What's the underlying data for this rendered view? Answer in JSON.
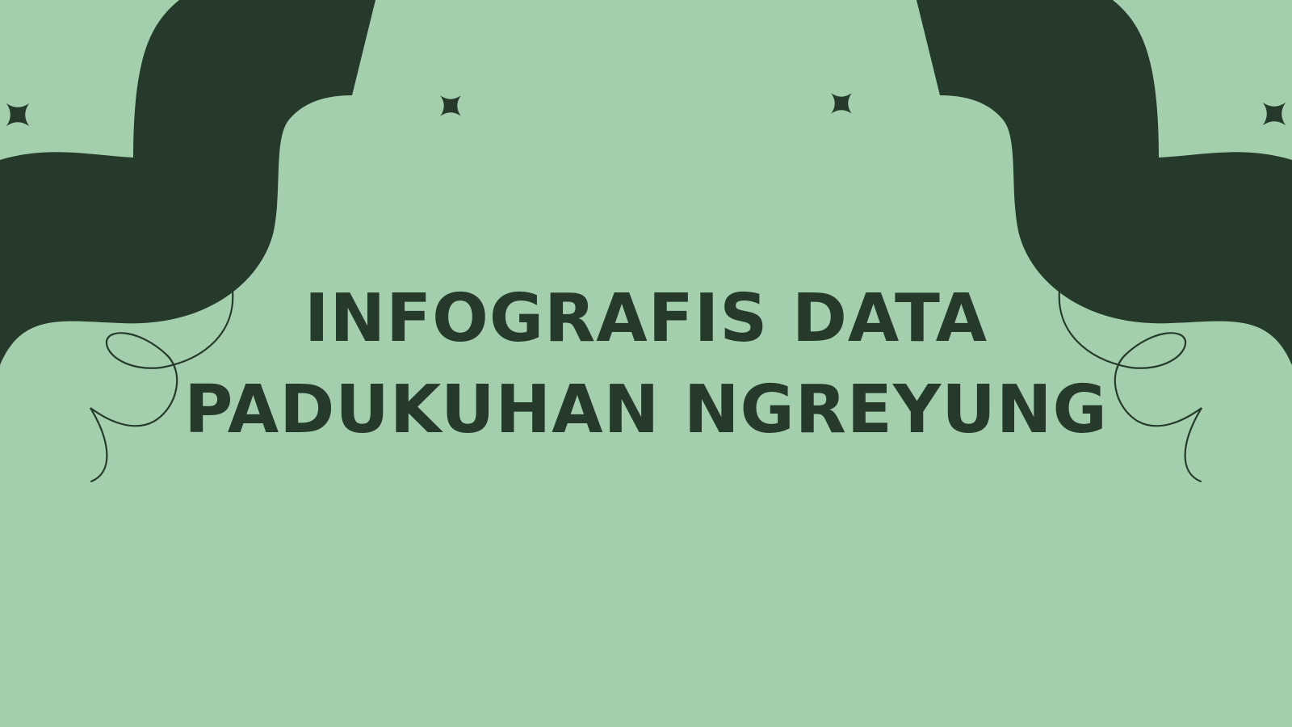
{
  "slide": {
    "title_line_1": "INFOGRAFIS DATA",
    "title_line_2": "PADUKUHAN NGREYUNG"
  },
  "colors": {
    "background": "#a4cfac",
    "shape": "#263a2c",
    "text": "#263a2c"
  },
  "icons": [
    "sparkle-star-icon",
    "swirl-line-decoration",
    "abstract-blob-shape"
  ]
}
